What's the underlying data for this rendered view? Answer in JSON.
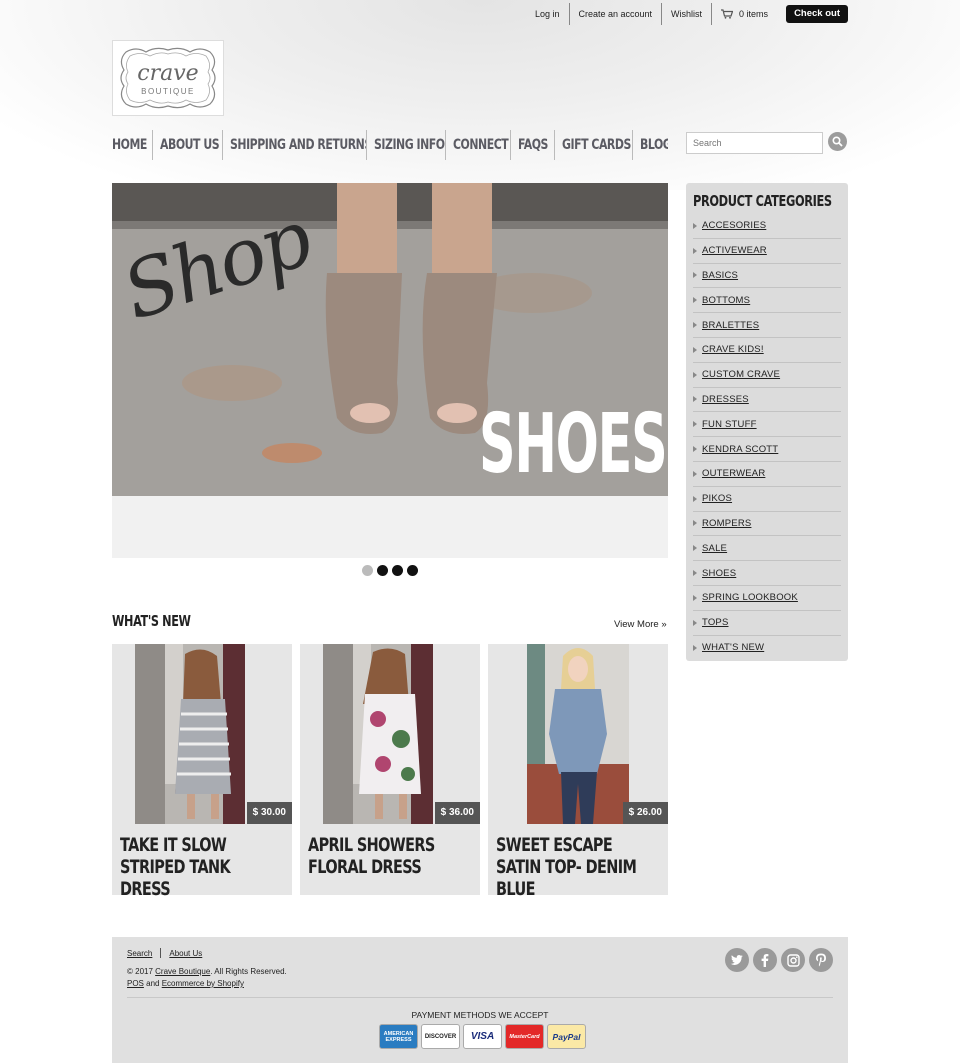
{
  "topbar": {
    "login": "Log in",
    "create_account": "Create an account",
    "wishlist": "Wishlist",
    "cart_count": "0 items",
    "checkout": "Check out"
  },
  "logo": {
    "line1": "crave",
    "line2": "BOUTIQUE"
  },
  "nav": [
    "HOME",
    "ABOUT US",
    "SHIPPING AND RETURNS",
    "SIZING INFO",
    "CONNECT",
    "FAQS",
    "GIFT CARDS",
    "BLOG"
  ],
  "search": {
    "placeholder": "Search"
  },
  "slideshow": {
    "script_text": "Shop",
    "headline": "SHOES",
    "slide_count": 4,
    "active_index": 0
  },
  "whats_new": {
    "title": "WHAT'S NEW",
    "view_more": "View More »",
    "products": [
      {
        "name": "TAKE IT SLOW STRIPED TANK DRESS",
        "price": "$ 30.00"
      },
      {
        "name": "APRIL SHOWERS FLORAL DRESS",
        "price": "$ 36.00"
      },
      {
        "name": "SWEET ESCAPE SATIN TOP- DENIM BLUE",
        "price": "$ 26.00"
      }
    ]
  },
  "sidebar": {
    "title": "PRODUCT CATEGORIES",
    "categories": [
      "ACCESORIES",
      "ACTIVEWEAR",
      "BASICS",
      "BOTTOMS",
      "BRALETTES",
      "CRAVE KIDS!",
      "CUSTOM CRAVE",
      "DRESSES",
      "FUN STUFF",
      "KENDRA SCOTT",
      "OUTERWEAR",
      "PIKOS",
      "ROMPERS",
      "SALE",
      "SHOES",
      "SPRING LOOKBOOK",
      "TOPS",
      "WHAT'S NEW"
    ]
  },
  "footer": {
    "links": [
      "Search",
      "About Us"
    ],
    "copy_prefix": "© 2017 ",
    "copy_brand": "Crave Boutique",
    "copy_suffix": ". All Rights Reserved.",
    "pos": "POS",
    "and": " and ",
    "ecommerce": "Ecommerce by Shopify",
    "payment_title": "PAYMENT METHODS WE ACCEPT",
    "payments": [
      "AMERICAN EXPRESS",
      "DISCOVER",
      "VISA",
      "MasterCard",
      "PayPal"
    ],
    "social_icons": [
      "twitter-icon",
      "facebook-icon",
      "instagram-icon",
      "pinterest-icon"
    ]
  },
  "colors": {
    "nav_text": "#5b5b63",
    "checkout_bg": "#111111",
    "sidebar_bg": "#dcdcdc",
    "product_bg": "#e6e6e6",
    "price_bg": "#555555"
  }
}
